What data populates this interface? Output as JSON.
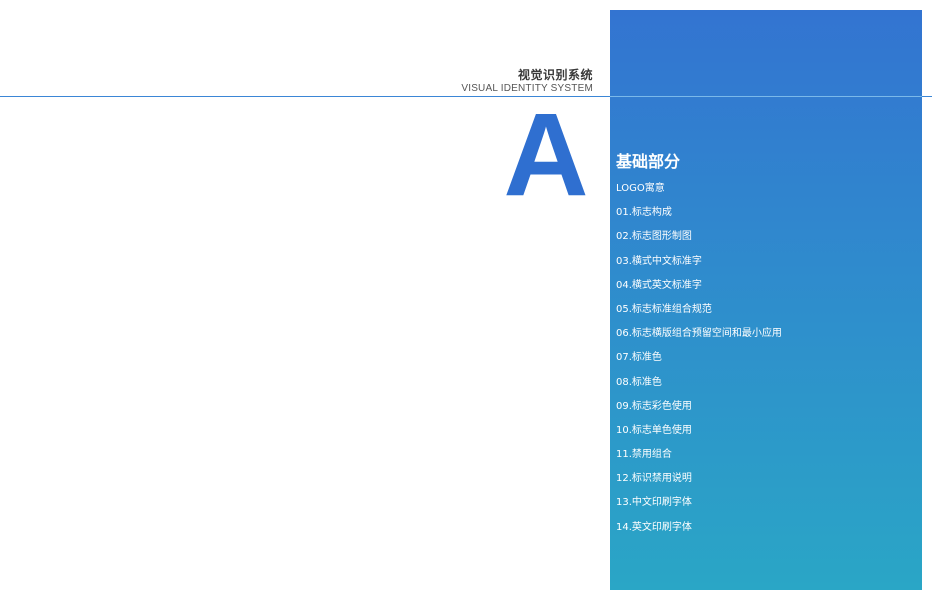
{
  "header": {
    "title_cn": "视觉识别系统",
    "title_en": "VISUAL IDENTITY SYSTEM"
  },
  "section": {
    "letter": "A",
    "title": "基础部分",
    "items": [
      "LOGO寓意",
      "01.标志构成",
      "02.标志图形制图",
      "03.横式中文标准字",
      "04.横式英文标准字",
      "05.标志标准组合规范",
      "06.标志横版组合预留空间和最小应用",
      "07.标准色",
      "08.标准色",
      "09.标志彩色使用",
      "10.标志单色使用",
      "11.禁用组合",
      "12.标识禁用说明",
      "13.中文印刷字体",
      "14.英文印刷字体"
    ]
  },
  "colors": {
    "accent": "#2f6fd0",
    "panel_top": "#3374d1",
    "panel_bottom": "#2aa6c6",
    "rule": "#3b86d6"
  }
}
